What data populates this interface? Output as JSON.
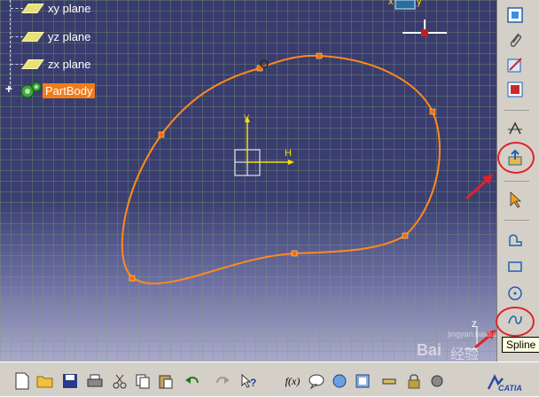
{
  "tree": {
    "items": [
      {
        "label": "xy plane"
      },
      {
        "label": "yz plane"
      },
      {
        "label": "zx plane"
      }
    ],
    "part_body": {
      "label": "PartBody"
    },
    "expander_symbol": "+"
  },
  "canvas": {
    "axis_v_label": "V",
    "axis_h_label": "H",
    "compass_x": "x",
    "compass_y": "y",
    "compass_z": "z"
  },
  "tooltip": {
    "text": "Spline"
  },
  "watermark": {
    "text1": "Bai",
    "text2": "经验",
    "text3": "jingyan.baidu.com"
  },
  "bottom_toolbar": {
    "fx_label": "f(x)",
    "catia_label": "CATIA"
  },
  "icons": [
    "bring-to-front-icon",
    "paperclip-icon",
    "sketch-edit-icon",
    "grid-snap-icon",
    "transform-icon",
    "exit-workbench-icon",
    "select-arrow-icon",
    "profile-icon",
    "rectangle-icon",
    "circle-icon",
    "spline-icon"
  ],
  "colors": {
    "accent": "#f07c1a",
    "highlight": "#e0222a",
    "spline": "#ff8a1c",
    "axis": "#f5e000"
  }
}
